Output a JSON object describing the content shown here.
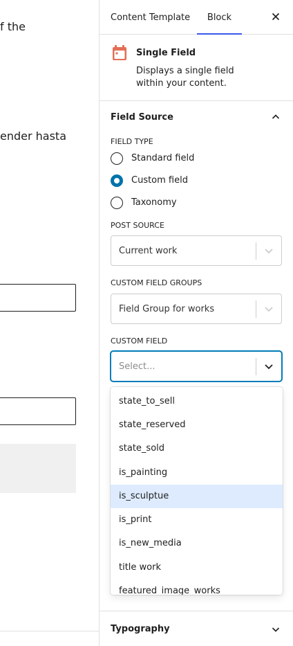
{
  "editor": {
    "text_line_1": "f the",
    "text_line_2": "ender hasta"
  },
  "sidebar": {
    "tabs": [
      {
        "label": "Content Template"
      },
      {
        "label": "Block"
      }
    ],
    "close_icon": "close-icon",
    "block": {
      "icon": "calendar-icon",
      "icon_color": "#e26f56",
      "title": "Single Field",
      "description": "Displays a single field within your content."
    },
    "field_source": {
      "title": "Field Source",
      "field_type_label": "FIELD TYPE",
      "field_types": [
        {
          "label": "Standard field",
          "checked": false
        },
        {
          "label": "Custom field",
          "checked": true
        },
        {
          "label": "Taxonomy",
          "checked": false
        }
      ],
      "post_source_label": "POST SOURCE",
      "post_source_value": "Current work",
      "custom_field_groups_label": "CUSTOM FIELD GROUPS",
      "custom_field_groups_value": "Field Group for works",
      "custom_field_label": "CUSTOM FIELD",
      "custom_field_placeholder": "Select...",
      "options": [
        "state_to_sell",
        "state_reserved",
        "state_sold",
        "is_painting",
        "is_sculptue",
        "is_print",
        "is_new_media",
        "title work",
        "featured_image_works"
      ],
      "highlighted_option": "is_sculptue"
    },
    "typography": {
      "title": "Typography"
    }
  },
  "colors": {
    "accent": "#3858e9",
    "radio_checked": "#0073aa",
    "focus_border": "#007cba",
    "option_highlight": "#deebff"
  }
}
